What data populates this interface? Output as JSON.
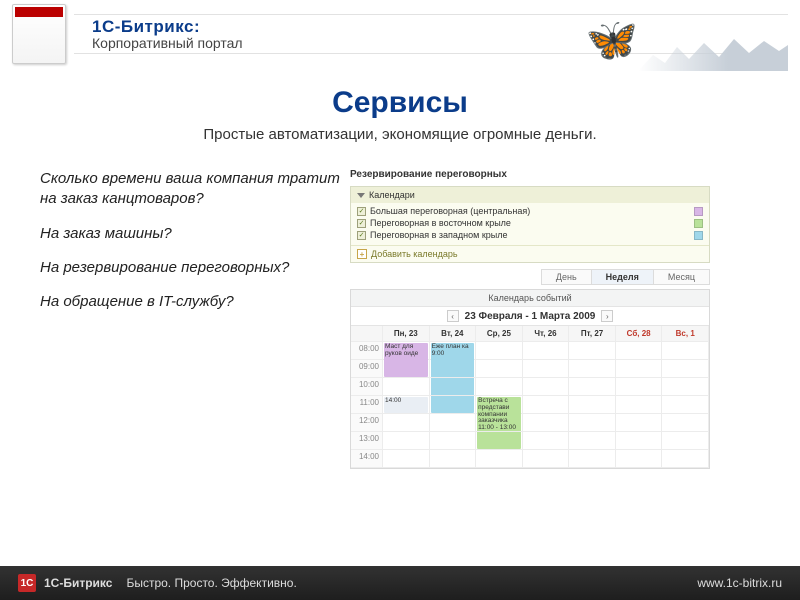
{
  "header": {
    "brand_line1": "1С-Битрикс:",
    "brand_line2": "Корпоративный портал"
  },
  "title": "Сервисы",
  "subtitle": "Простые автоматизации, экономящие огромные деньги.",
  "left": {
    "p1": "Сколько времени ваша компания тратит на заказ канцтоваров?",
    "p2": "На заказ машины?",
    "p3": "На резервирование переговорных?",
    "p4": "На обращение в IT-службу?"
  },
  "widget": {
    "title": "Резервирование переговорных",
    "calendars_header": "Календари",
    "add_calendar": "Добавить календарь",
    "calendars": [
      {
        "label": "Большая переговорная (центральная)",
        "color": "#d8b6e6"
      },
      {
        "label": "Переговорная в восточном крыле",
        "color": "#b9e29a"
      },
      {
        "label": "Переговорная в западном крыле",
        "color": "#9fd7ea"
      }
    ],
    "views": {
      "day": "День",
      "week": "Неделя",
      "month": "Месяц"
    },
    "grid_title": "Календарь событий",
    "date_range": "23 Февраля - 1 Марта 2009",
    "days": [
      {
        "label": "Пн, 23",
        "cls": ""
      },
      {
        "label": "Вт, 24",
        "cls": ""
      },
      {
        "label": "Ср, 25",
        "cls": ""
      },
      {
        "label": "Чт, 26",
        "cls": ""
      },
      {
        "label": "Пт, 27",
        "cls": ""
      },
      {
        "label": "Сб, 28",
        "cls": "sat"
      },
      {
        "label": "Вс, 1",
        "cls": "sun"
      }
    ],
    "times": [
      "08:00",
      "09:00",
      "10:00",
      "11:00",
      "12:00",
      "13:00",
      "14:00"
    ],
    "events": [
      {
        "row": 0,
        "col": 0,
        "span": 2,
        "color": "#d8b6e6",
        "text": "Маст для руков оиде"
      },
      {
        "row": 0,
        "col": 1,
        "span": 4,
        "color": "#9fd7ea",
        "text": "Еже план ка 9:00"
      },
      {
        "row": 3,
        "col": 0,
        "span": 1,
        "color": "#e9eef4",
        "text": "14:00"
      },
      {
        "row": 3,
        "col": 2,
        "span": 3,
        "color": "#b9e29a",
        "text": "Встреча с представи компании заказчика 11:00 - 13:00"
      }
    ]
  },
  "footer": {
    "brand": "1С-Битрикс",
    "tagline": "Быстро. Просто. Эффективно.",
    "url": "www.1c-bitrix.ru"
  }
}
